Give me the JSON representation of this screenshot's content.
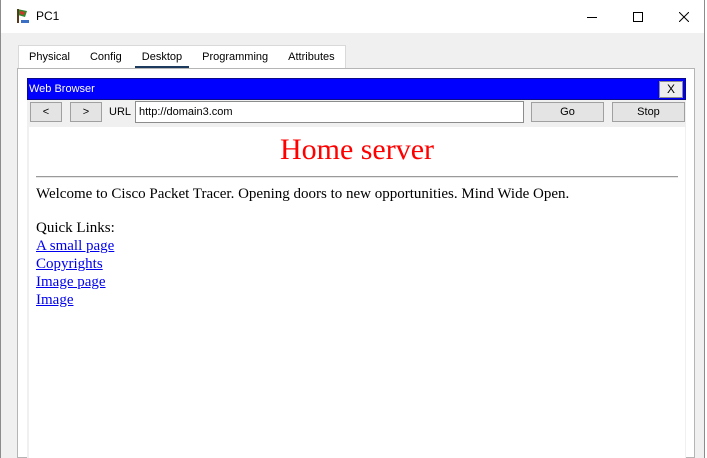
{
  "window": {
    "title": "PC1",
    "controls": {
      "minimize_icon": "minimize-icon",
      "maximize_icon": "maximize-icon",
      "close_icon": "close-icon"
    }
  },
  "tabs": [
    {
      "label": "Physical",
      "active": false
    },
    {
      "label": "Config",
      "active": false
    },
    {
      "label": "Desktop",
      "active": true
    },
    {
      "label": "Programming",
      "active": false
    },
    {
      "label": "Attributes",
      "active": false
    }
  ],
  "browser": {
    "title": "Web Browser",
    "close_label": "X",
    "back_label": "<",
    "forward_label": ">",
    "url_label": "URL",
    "url_value": "http://domain3.com",
    "go_label": "Go",
    "stop_label": "Stop",
    "colors": {
      "titlebar": "#0000ff",
      "heading": "#ff0000",
      "link": "#0000ee"
    }
  },
  "page": {
    "heading": "Home server",
    "welcome": "Welcome to Cisco Packet Tracer. Opening doors to new opportunities. Mind Wide Open.",
    "quick_links_label": "Quick Links:",
    "links": [
      "A small page",
      "Copyrights",
      "Image page",
      "Image"
    ]
  }
}
